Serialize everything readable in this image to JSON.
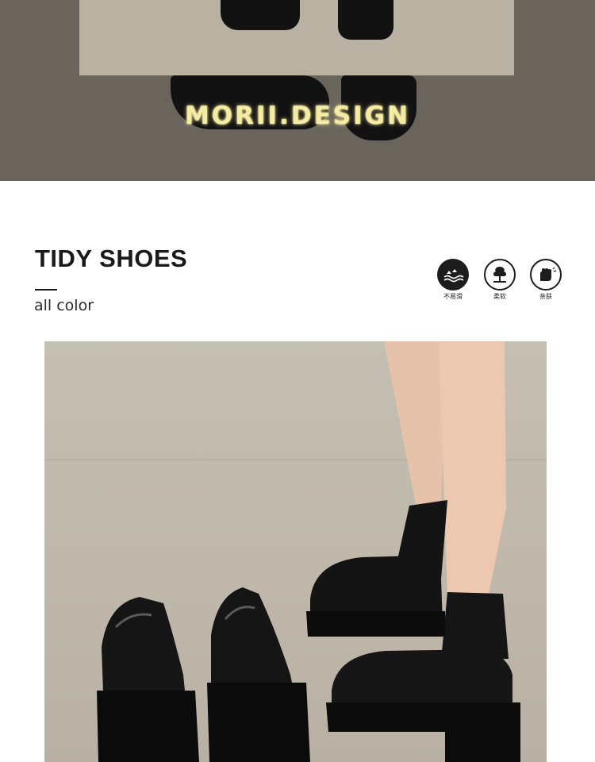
{
  "banner": {
    "title": "MORII.DESIGN"
  },
  "section": {
    "title": "TIDY SHOES",
    "subtitle": "all color"
  },
  "features": [
    {
      "icon": "anti-slip-icon",
      "label": "不易滑"
    },
    {
      "icon": "soft-tree-icon",
      "label": "柔软"
    },
    {
      "icon": "skin-friendly-icon",
      "label": "亲肤"
    }
  ],
  "product_photo": {
    "subject": "black loafers"
  }
}
